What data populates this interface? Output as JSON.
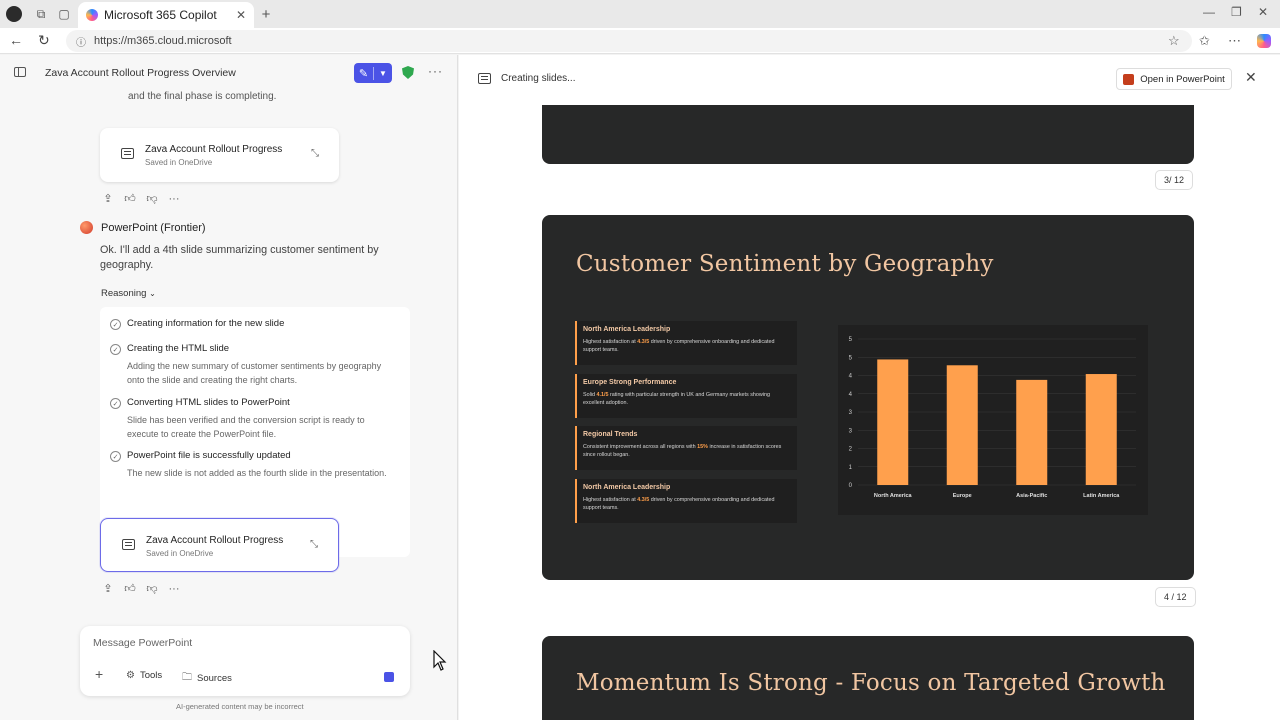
{
  "browser": {
    "tab_title": "Microsoft 365 Copilot",
    "url": "https://m365.cloud.microsoft"
  },
  "left_pane": {
    "conversation_title": "Zava Account Rollout Progress Overview",
    "top_fragment": "and the final phase is completing.",
    "file_card_1": {
      "title": "Zava Account Rollout Progress",
      "subtitle": "Saved in OneDrive"
    },
    "agent_name": "PowerPoint (Frontier)",
    "agent_message": "Ok. I'll add a 4th slide summarizing customer sentiment by geography.",
    "reasoning_label": "Reasoning",
    "steps": [
      {
        "title": "Creating information for the new slide",
        "desc": ""
      },
      {
        "title": "Creating the HTML slide",
        "desc": "Adding the new summary of customer sentiments by geography onto the slide and creating the right charts."
      },
      {
        "title": "Converting HTML slides to PowerPoint",
        "desc": "Slide has been verified and the conversion script is ready to execute to create the PowerPoint file."
      },
      {
        "title": "PowerPoint file is successfully updated",
        "desc": "The new slide is not added as the fourth slide in the presentation."
      }
    ],
    "file_card_2": {
      "title": "Zava Account Rollout Progress",
      "subtitle": "Saved in OneDrive"
    },
    "composer": {
      "placeholder": "Message PowerPoint",
      "tools_label": "Tools",
      "sources_label": "Sources"
    },
    "disclaimer": "AI-generated content may be incorrect"
  },
  "right_pane": {
    "status": "Creating slides...",
    "open_button": "Open in PowerPoint",
    "page_3": "3/ 12",
    "page_4": "4 / 12",
    "slide4": {
      "title": "Customer Sentiment by Geography",
      "cards": [
        {
          "title": "North America Leadership",
          "pre": "Highest satisfaction at ",
          "hl": "4.3/5",
          "post": " driven by comprehensive onboarding and dedicated support teams."
        },
        {
          "title": "Europe Strong Performance",
          "pre": "Solid ",
          "hl": "4.1/5",
          "post": " rating with particular strength in UK and Germany markets showing excellent adoption."
        },
        {
          "title": "Regional Trends",
          "pre": "Consistent improvement across all regions with ",
          "hl": "15%",
          "post": " increase in satisfaction scores since rollout began."
        },
        {
          "title": "North America Leadership",
          "pre": "Highest satisfaction at ",
          "hl": "4.3/5",
          "post": " driven by comprehensive onboarding and dedicated support teams."
        }
      ]
    },
    "slide5": {
      "title": "Momentum Is Strong - Focus on Targeted Growth"
    }
  },
  "colors": {
    "accent": "#4b53e6",
    "slide_bg": "#272828",
    "bar": "#ffa04d",
    "title_peach": "#f1c6a2"
  },
  "chart_data": {
    "type": "bar",
    "categories": [
      "North America",
      "Europe",
      "Asia-Pacific",
      "Latin America"
    ],
    "values": [
      4.3,
      4.1,
      3.6,
      3.8
    ],
    "yticks": [
      0,
      1,
      2,
      3,
      3,
      4,
      4,
      5,
      5
    ],
    "ylim": [
      0,
      5
    ],
    "grid": true
  }
}
